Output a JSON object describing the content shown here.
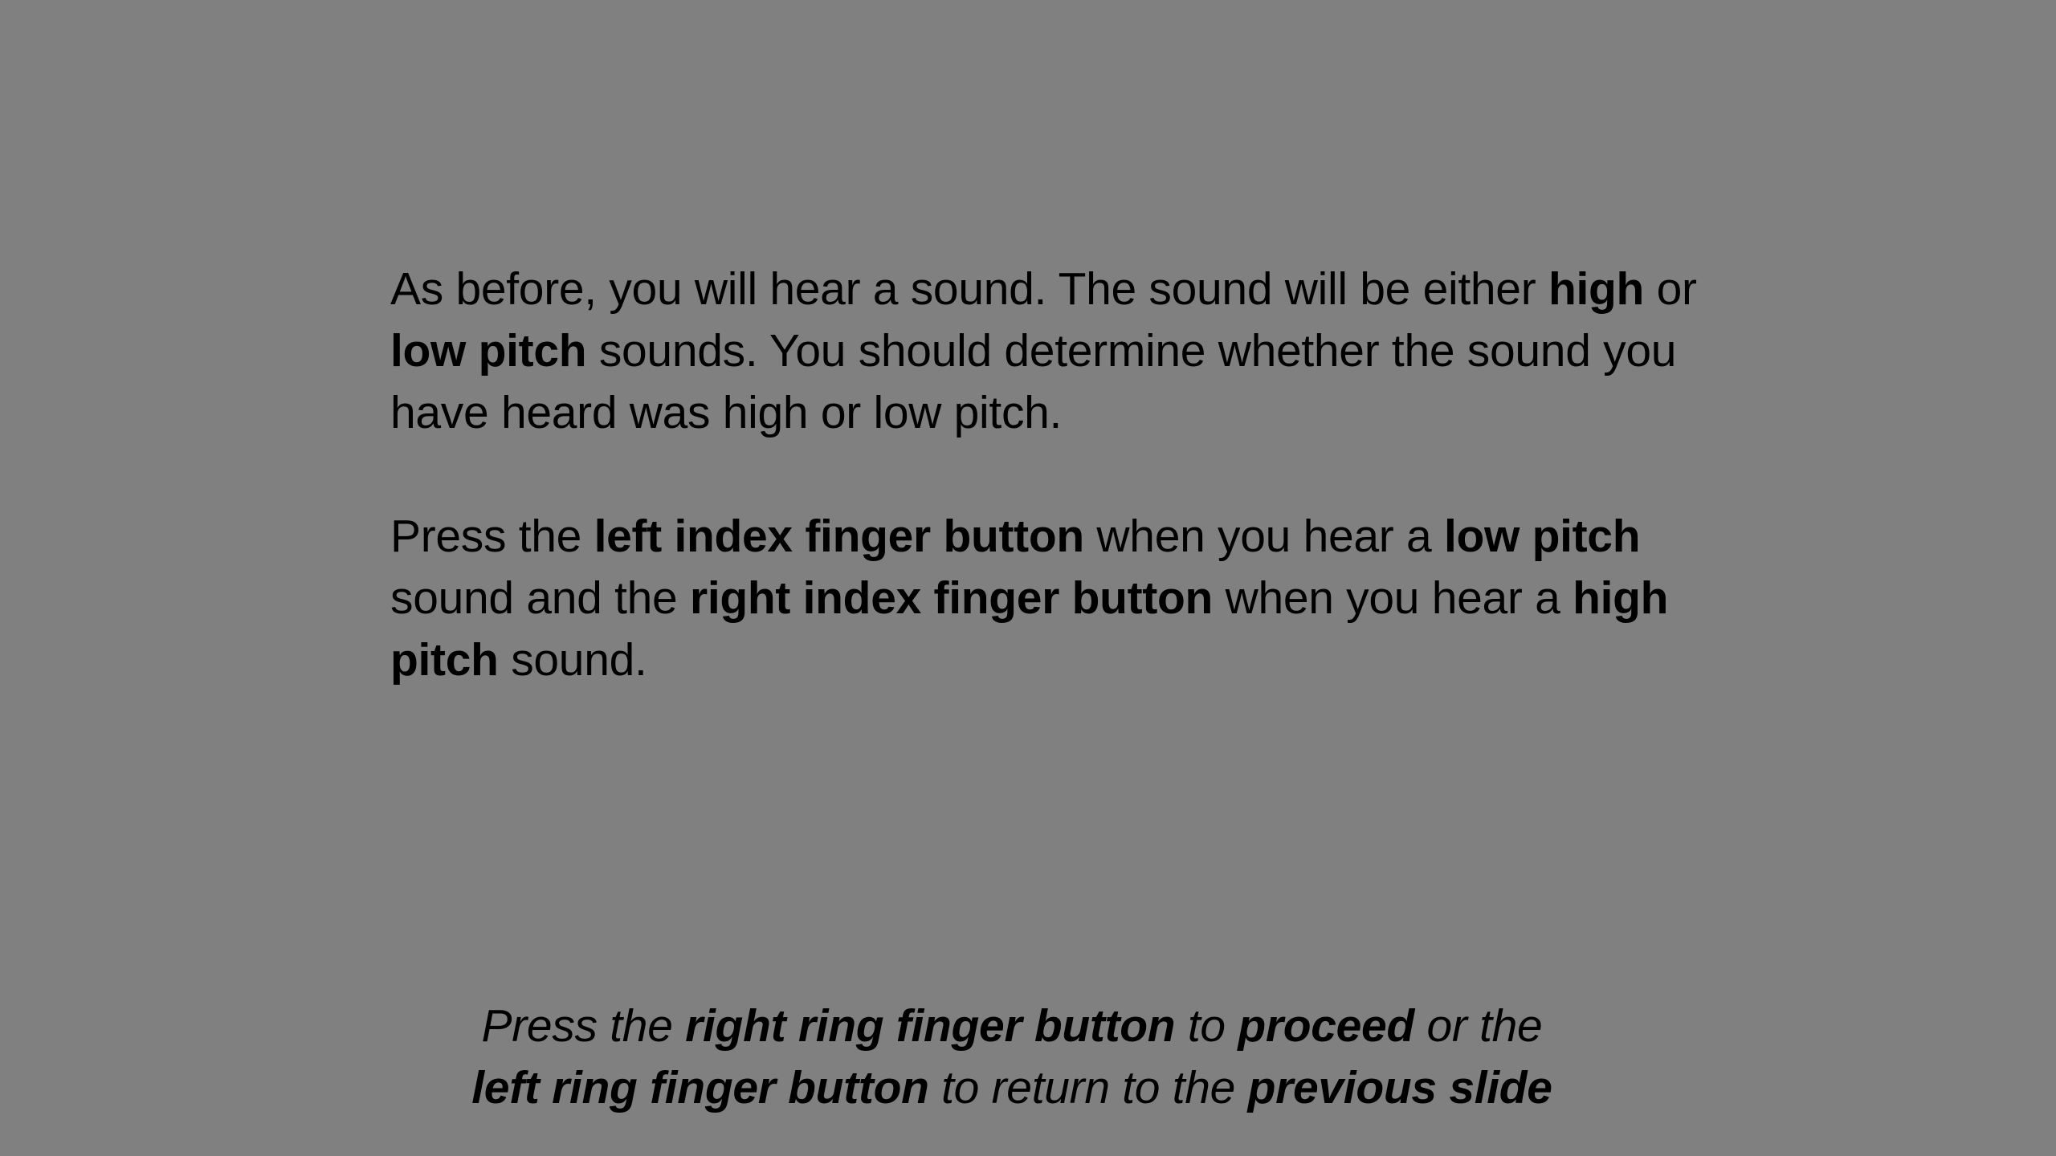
{
  "slide": {
    "background": "#808080",
    "text_color": "#000000"
  },
  "instructions": {
    "paragraph1": {
      "t1": "As before, you will hear a sound. The sound will be either ",
      "b1": "high",
      "t2": " or ",
      "b2": "low pitch",
      "t3": " sounds. You should determine whether the sound you have heard was high or low pitch."
    },
    "paragraph2": {
      "t1": "Press the ",
      "b1": "left index finger button",
      "t2": " when you hear a ",
      "b2": "low pitch",
      "t3": " sound and the ",
      "b3": "right index finger button",
      "t4": " when you hear a ",
      "b4": "high pitch",
      "t5": " sound."
    }
  },
  "navigation": {
    "line1": {
      "t1": "Press the ",
      "b1": "right ring finger button",
      "t2": " to ",
      "b2": "proceed",
      "t3": " or the"
    },
    "line2": {
      "b1": "left ring finger button",
      "t1": " to return to the ",
      "b2": "previous slide"
    }
  }
}
